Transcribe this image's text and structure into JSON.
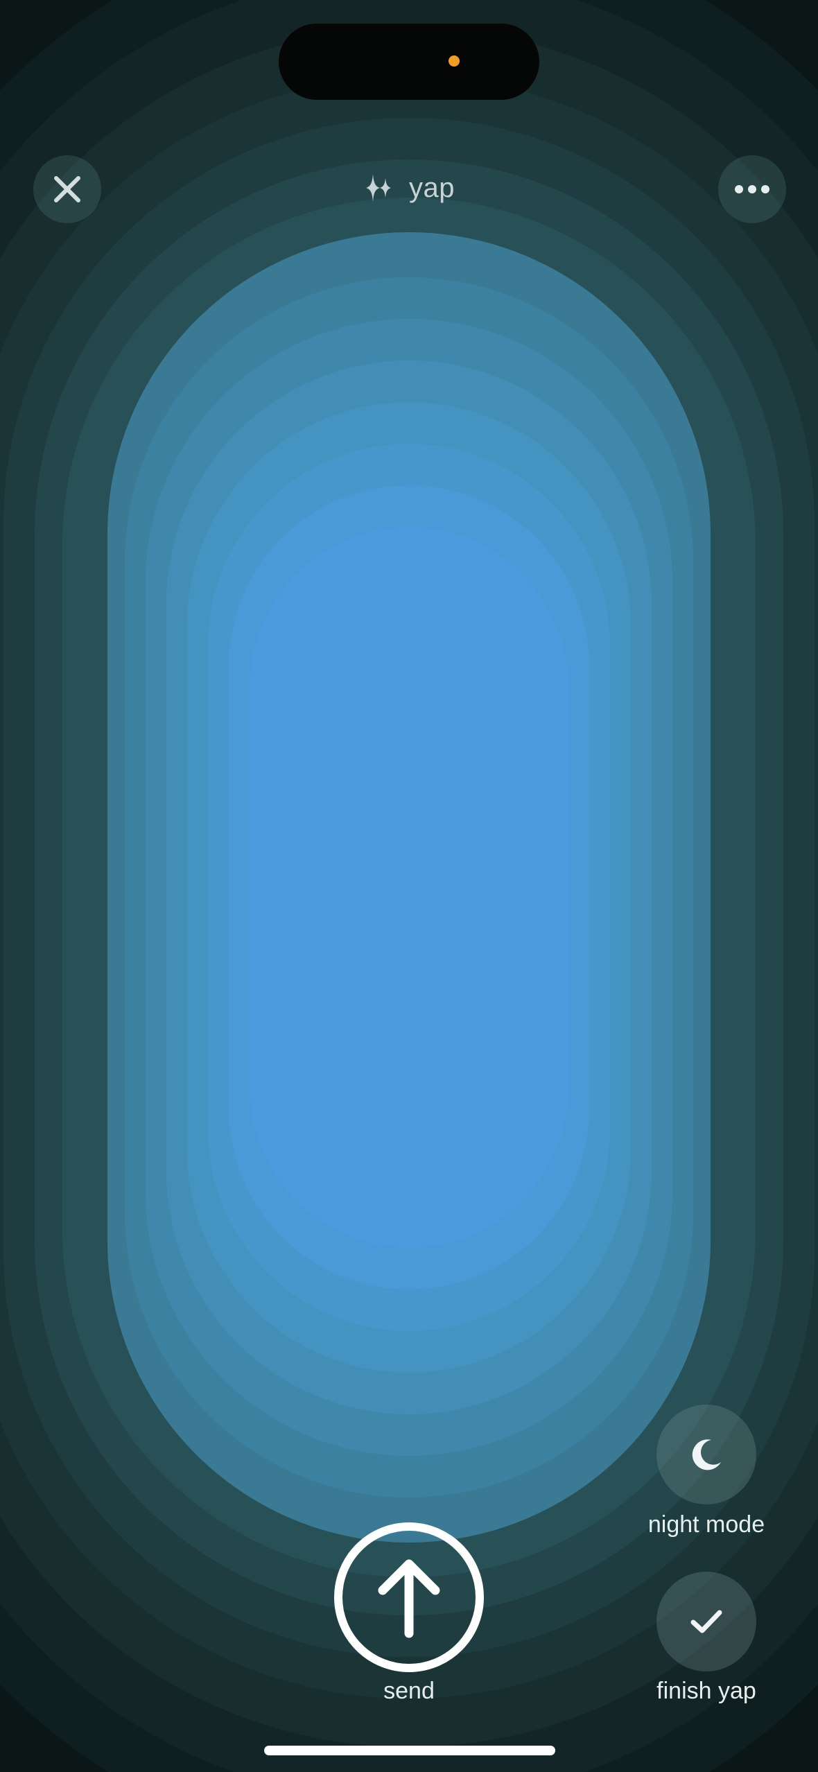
{
  "header": {
    "title": "yap",
    "title_icon": "waveform-sparkle-icon",
    "close_icon": "close-icon",
    "more_icon": "more-horizontal-icon"
  },
  "actions": {
    "send_label": "send",
    "night_mode_label": "night mode",
    "finish_label": "finish yap"
  },
  "colors": {
    "accent_center": "#4b9bdf",
    "background_edge": "#0b1616",
    "recording_indicator": "#f0a020"
  }
}
